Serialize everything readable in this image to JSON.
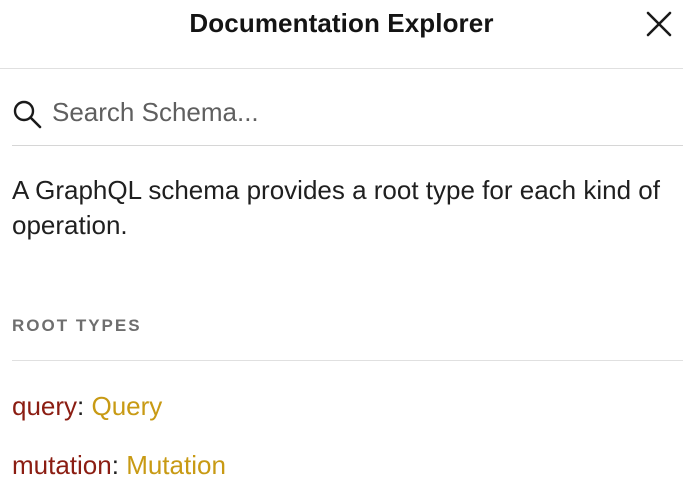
{
  "header": {
    "title": "Documentation Explorer",
    "close_icon": "close-icon"
  },
  "search": {
    "icon": "search-icon",
    "placeholder": "Search Schema...",
    "value": ""
  },
  "description": "A GraphQL schema provides a root type for each kind of operation.",
  "root_types": {
    "title": "ROOT TYPES",
    "items": [
      {
        "field": "query",
        "separator": ": ",
        "type": "Query"
      },
      {
        "field": "mutation",
        "separator": ": ",
        "type": "Mutation"
      }
    ]
  },
  "colors": {
    "field": "#8b1d12",
    "type": "#c89a14",
    "section_title": "#6e6e6e"
  }
}
